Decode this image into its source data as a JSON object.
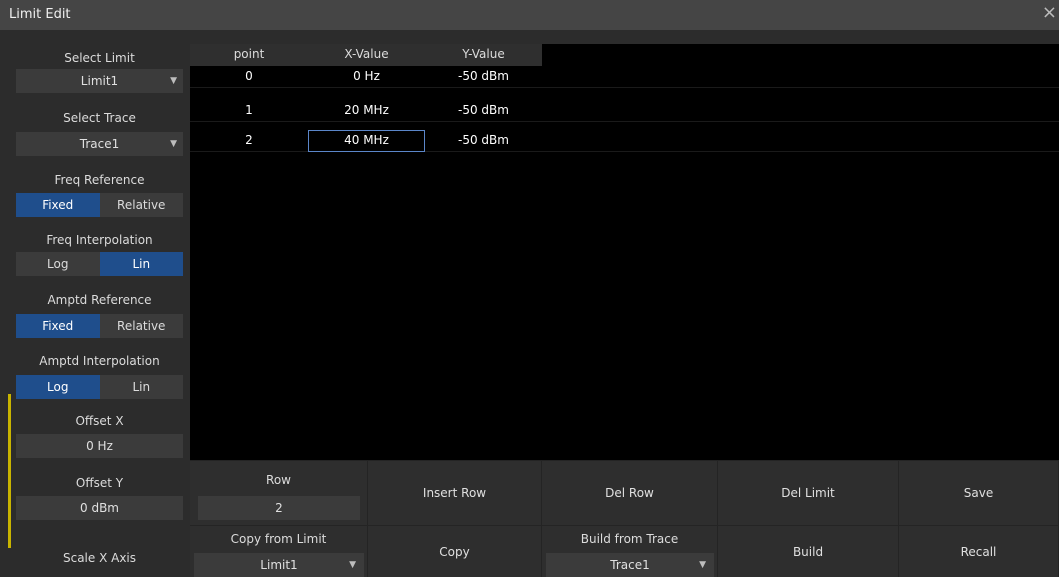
{
  "window": {
    "title": "Limit Edit",
    "close_glyph": "×"
  },
  "sidebar": {
    "select_limit": {
      "label": "Select Limit",
      "value": "Limit1"
    },
    "select_trace": {
      "label": "Select Trace",
      "value": "Trace1"
    },
    "freq_reference": {
      "label": "Freq Reference",
      "options": [
        "Fixed",
        "Relative"
      ],
      "selected": "Fixed"
    },
    "freq_interpolation": {
      "label": "Freq Interpolation",
      "options": [
        "Log",
        "Lin"
      ],
      "selected": "Lin"
    },
    "amptd_reference": {
      "label": "Amptd Reference",
      "options": [
        "Fixed",
        "Relative"
      ],
      "selected": "Fixed"
    },
    "amptd_interpolation": {
      "label": "Amptd Interpolation",
      "options": [
        "Log",
        "Lin"
      ],
      "selected": "Log"
    },
    "offset_x": {
      "label": "Offset X",
      "value": "0 Hz"
    },
    "offset_y": {
      "label": "Offset Y",
      "value": "0 dBm"
    },
    "scale_x_axis": "Scale X Axis"
  },
  "table": {
    "headers": [
      "point",
      "X-Value",
      "Y-Value"
    ],
    "rows": [
      {
        "point": "0",
        "x": "0 Hz",
        "y": "-50 dBm"
      },
      {
        "point": "1",
        "x": "20 MHz",
        "y": "-50 dBm"
      },
      {
        "point": "2",
        "x": "40 MHz",
        "y": "-50 dBm"
      }
    ],
    "selected_row": 2,
    "selected_column": "X-Value"
  },
  "buttons": {
    "row": {
      "label": "Row",
      "value": "2"
    },
    "insert_row": "Insert Row",
    "del_row": "Del Row",
    "del_limit": "Del Limit",
    "save": "Save",
    "copy_from_limit": {
      "label": "Copy from Limit",
      "value": "Limit1"
    },
    "copy": "Copy",
    "build_from_trace": {
      "label": "Build from Trace",
      "value": "Trace1"
    },
    "build": "Build",
    "recall": "Recall"
  },
  "colors": {
    "accent_selected": "#1f4e8c",
    "cell_highlight": "#5b86c9",
    "marker": "#c8b400"
  },
  "icons": {
    "dropdown_arrow": "▼"
  }
}
